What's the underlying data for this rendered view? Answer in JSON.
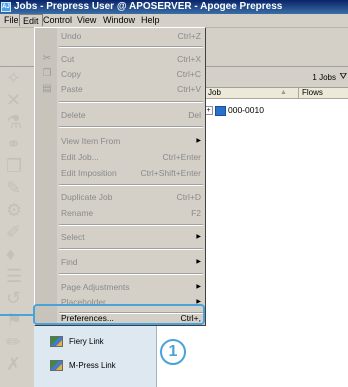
{
  "window": {
    "title": "Jobs - Prepress User @ APOSERVER - Apogee Prepress",
    "app_icon": "AJ"
  },
  "menubar": [
    "File",
    "Edit",
    "Control",
    "View",
    "Window",
    "Help"
  ],
  "edit_menu": {
    "items": [
      {
        "label": "Undo",
        "shortcut": "Ctrl+Z",
        "icon": ""
      },
      {
        "label": "Cut",
        "shortcut": "Ctrl+X",
        "icon": "scissors-icon"
      },
      {
        "label": "Copy",
        "shortcut": "Ctrl+C",
        "icon": "copy-icon"
      },
      {
        "label": "Paste",
        "shortcut": "Ctrl+V",
        "icon": "paste-icon"
      },
      {
        "label": "Delete",
        "shortcut": "Del",
        "icon": ""
      },
      {
        "label": "View Item From",
        "shortcut": "",
        "submenu": true
      },
      {
        "label": "Edit Job...",
        "shortcut": "Ctrl+Enter"
      },
      {
        "label": "Edit Imposition",
        "shortcut": "Ctrl+Shift+Enter"
      },
      {
        "label": "Duplicate Job",
        "shortcut": "Ctrl+D"
      },
      {
        "label": "Rename",
        "shortcut": "F2"
      },
      {
        "label": "Select",
        "shortcut": "",
        "submenu": true
      },
      {
        "label": "Find",
        "shortcut": "",
        "submenu": true
      },
      {
        "label": "Page Adjustments",
        "shortcut": "",
        "submenu": true
      },
      {
        "label": "Placeholder",
        "shortcut": "",
        "submenu": true
      },
      {
        "label": "Preferences...",
        "shortcut": "Ctrl+,"
      }
    ]
  },
  "jobs_panel": {
    "count": "1 Jobs",
    "columns": [
      "Job",
      "Flows"
    ],
    "rows": [
      {
        "name": "000-0010"
      }
    ]
  },
  "plugins": [
    {
      "label": "Fiery Link"
    },
    {
      "label": "M-Press Link"
    }
  ],
  "callout": {
    "number": "1"
  },
  "colors": {
    "accent": "#4aa3d8",
    "menu_bg": "#d4d0c8",
    "title_bar": "#0a246a"
  }
}
